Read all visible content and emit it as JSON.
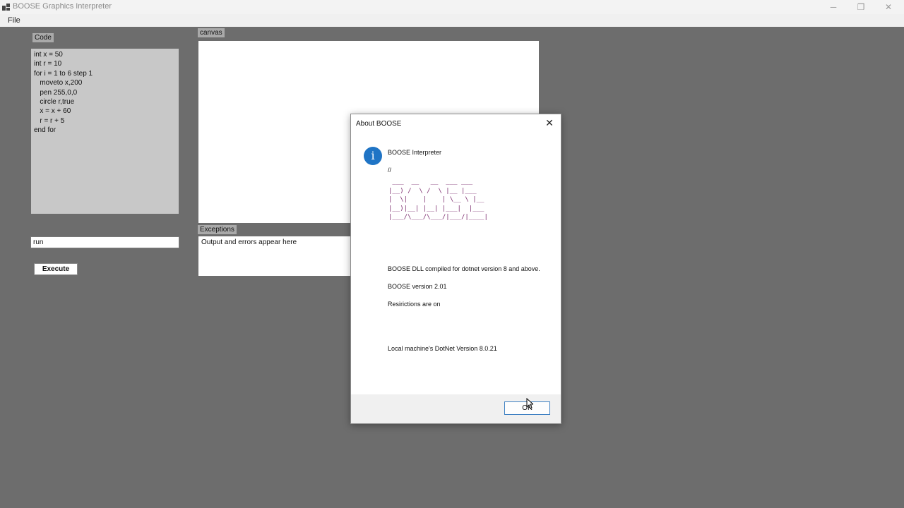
{
  "window": {
    "title": "BOOSE Graphics Interpreter",
    "minimize_glyph": "─",
    "maximize_glyph": "❐",
    "close_glyph": "✕"
  },
  "menu": {
    "file": "File"
  },
  "code_panel": {
    "label": "Code",
    "lines": [
      "int x = 50",
      "int r = 10",
      "for i = 1 to 6 step 1",
      "   moveto x,200",
      "   pen 255,0,0",
      "   circle r,true",
      "   x = x + 60",
      "   r = r + 5",
      "end for"
    ]
  },
  "command": {
    "value": "run"
  },
  "execute_button": "Execute",
  "canvas_label": "canvas",
  "exceptions": {
    "label": "Exceptions",
    "text": "Output and errors appear here"
  },
  "dialog": {
    "title": "About BOOSE",
    "close_glyph": "✕",
    "info_icon_glyph": "i",
    "heading": "BOOSE Interpreter",
    "slashes": "//",
    "ascii_art": " ___  __   __  ___ ___\n|__) /  \\ /  \\ |__ |___\n|  \\|    |    | \\__ \\ |__\n|__)|__| |__| |___|  |___\n|___/\\___/\\___/|___/|____|",
    "dll_text": "BOOSE DLL compiled for dotnet version 8 and above.",
    "version_text": "BOOSE version 2.01",
    "restrictions_text": "Resirictions are on",
    "dotnet_text": "Local machine's DotNet Version 8.0.21",
    "ok_button": "OK"
  },
  "colors": {
    "background": "#6d6d6d",
    "code_bg": "#c8c8c8",
    "info_icon": "#1f74c5",
    "ascii_art": "#7b2b6d",
    "ok_border": "#3c7fc2"
  }
}
